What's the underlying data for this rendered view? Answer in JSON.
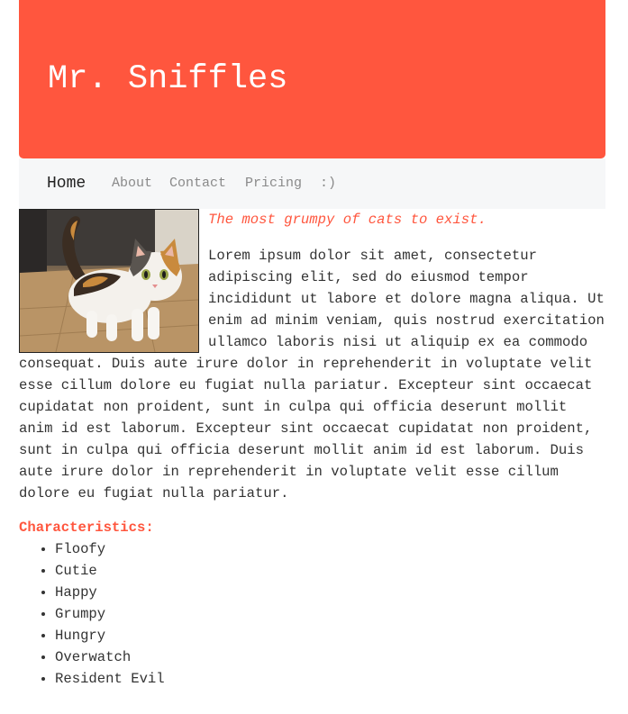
{
  "header": {
    "title": "Mr. Sniffles"
  },
  "nav": {
    "items": [
      {
        "label": "Home",
        "active": true
      },
      {
        "label": "About",
        "active": false
      },
      {
        "label": "Contact",
        "active": false
      },
      {
        "label": "Pricing",
        "active": false
      },
      {
        "label": ":)",
        "active": false
      }
    ]
  },
  "main": {
    "image_subject": "calico-cat-photo",
    "tagline": "The most grumpy of cats to exist.",
    "body": "Lorem ipsum dolor sit amet, consectetur adipiscing elit, sed do eiusmod tempor incididunt ut labore et dolore magna aliqua. Ut enim ad minim veniam, quis nostrud exercitation ullamco laboris nisi ut aliquip ex ea commodo consequat. Duis aute irure dolor in reprehenderit in voluptate velit esse cillum dolore eu fugiat nulla pariatur. Excepteur sint occaecat cupidatat non proident, sunt in culpa qui officia deserunt mollit anim id est laborum. Excepteur sint occaecat cupidatat non proident, sunt in culpa qui officia deserunt mollit anim id est laborum. Duis aute irure dolor in reprehenderit in voluptate velit esse cillum dolore eu fugiat nulla pariatur.",
    "characteristics_title": "Characteristics:",
    "characteristics": [
      "Floofy",
      "Cutie",
      "Happy",
      "Grumpy",
      "Hungry",
      "Overwatch",
      "Resident Evil"
    ]
  },
  "colors": {
    "accent": "#ff563e",
    "nav_background": "#f6f7f8",
    "text": "#333333"
  }
}
